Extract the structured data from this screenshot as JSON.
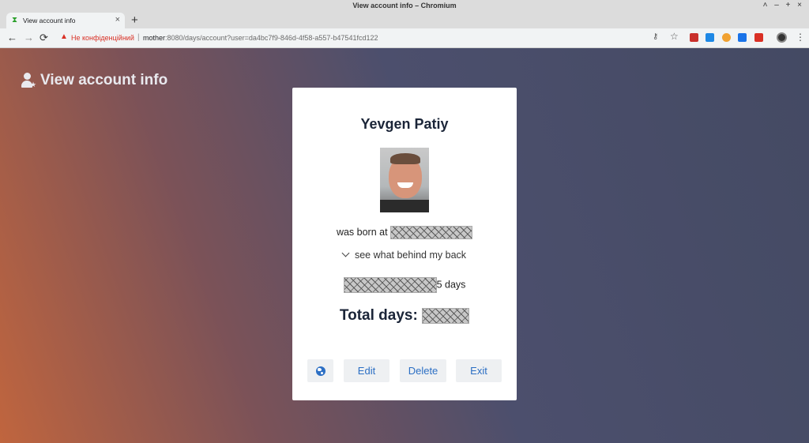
{
  "window": {
    "title": "View account info – Chromium",
    "controls": "˄ – + ×"
  },
  "tab": {
    "title": "View account info",
    "close": "×",
    "new_tab": "+"
  },
  "toolbar": {
    "back": "←",
    "forward": "→",
    "reload": "⟳",
    "security_warning": "Не конфіденційний",
    "separator": "|",
    "url_host": "mother",
    "url_rest": ":8080/days/account?user=da4bc7f9-846d-4f58-a557-b47541fcd122",
    "extensions": [
      {
        "name": "ublock-icon",
        "color": "#c9302c"
      },
      {
        "name": "s-extension-icon",
        "color": "#1e88e5"
      },
      {
        "name": "circle-extension-icon",
        "color": "#f1a130"
      },
      {
        "name": "screenshot-extension-icon",
        "color": "#1a73e8"
      },
      {
        "name": "red-extension-icon",
        "color": "#d93025"
      }
    ]
  },
  "page": {
    "heading": "View account info"
  },
  "account": {
    "name": "Yevgen Patiy",
    "born_label": "was born at",
    "collapse_label": "see what behind my back",
    "days_suffix": "5 days",
    "total_label": "Total days:"
  },
  "buttons": {
    "edit": "Edit",
    "delete": "Delete",
    "exit": "Exit"
  },
  "colors": {
    "accent": "#2c6fc4",
    "heading_text": "#1b2538",
    "warning": "#d93025"
  }
}
